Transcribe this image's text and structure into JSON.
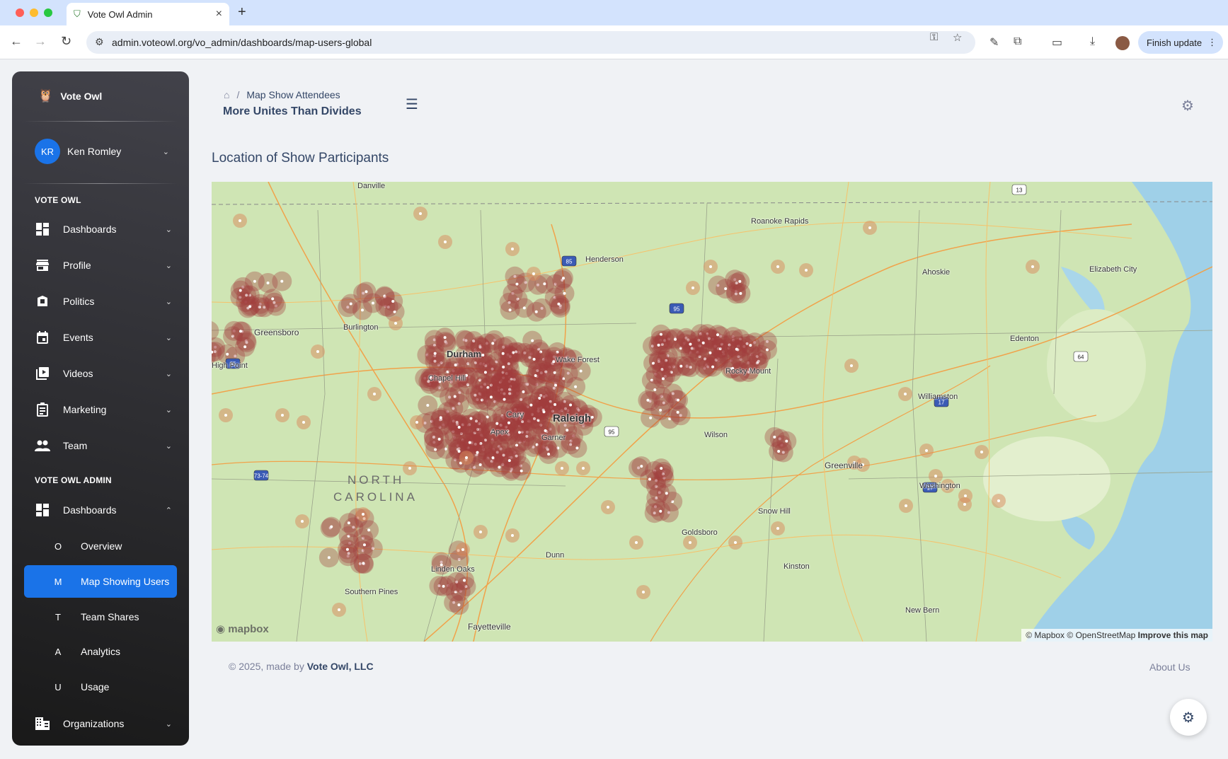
{
  "browser": {
    "tab_title": "Vote Owl Admin",
    "url": "admin.voteowl.org/vo_admin/dashboards/map-users-global",
    "finish_update_label": "Finish update",
    "traffic_colors": [
      "#ff5f57",
      "#febc2e",
      "#28c840"
    ]
  },
  "sidebar": {
    "brand": "Vote Owl",
    "user": {
      "initials": "KR",
      "name": "Ken Romley"
    },
    "section_main": "VOTE OWL",
    "items": [
      {
        "label": "Dashboards",
        "icon": "dashboard-icon"
      },
      {
        "label": "Profile",
        "icon": "store-icon"
      },
      {
        "label": "Politics",
        "icon": "ballot-icon"
      },
      {
        "label": "Events",
        "icon": "calendar-icon"
      },
      {
        "label": "Videos",
        "icon": "video-library-icon"
      },
      {
        "label": "Marketing",
        "icon": "clipboard-icon"
      },
      {
        "label": "Team",
        "icon": "people-icon"
      }
    ],
    "section_admin": "VOTE OWL ADMIN",
    "admin_dashboards_label": "Dashboards",
    "admin_sub_items": [
      {
        "letter": "O",
        "label": "Overview",
        "active": false
      },
      {
        "letter": "M",
        "label": "Map Showing Users",
        "active": true
      },
      {
        "letter": "T",
        "label": "Team Shares",
        "active": false
      },
      {
        "letter": "A",
        "label": "Analytics",
        "active": false
      },
      {
        "letter": "U",
        "label": "Usage",
        "active": false
      }
    ],
    "organizations_label": "Organizations",
    "active_color": "#1a73e8"
  },
  "header": {
    "breadcrumb_current": "Map Show Attendees",
    "page_title": "More Unites Than Divides"
  },
  "main": {
    "section_title": "Location of Show Participants",
    "map": {
      "labels": {
        "danville": "Danville",
        "roanoke_rapids": "Roanoke Rapids",
        "henderson": "Henderson",
        "ahoskie": "Ahoskie",
        "elizabeth_city": "Elizabeth City",
        "burlington": "Burlington",
        "greensboro": "Greensboro",
        "high_point": "High Point",
        "durham": "Durham",
        "chapel_hill": "Chapel Hill",
        "wake_forest": "Wake Forest",
        "rocky_mount": "Rocky Mount",
        "edenton": "Edenton",
        "cary": "Cary",
        "raleigh": "Raleigh",
        "apex": "Apex",
        "garner": "Garner",
        "wilson": "Wilson",
        "williamston": "Williamston",
        "north": "NORTH",
        "carolina": "CAROLINA",
        "greenville": "Greenville",
        "washington": "Washington",
        "snow_hill": "Snow Hill",
        "goldsboro": "Goldsboro",
        "dunn": "Dunn",
        "linden_oaks": "Linden Oaks",
        "kinston": "Kinston",
        "southern_pines": "Southern Pines",
        "new_bern": "New Bern",
        "fayetteville": "Fayetteville"
      },
      "shields": [
        "13",
        "85",
        "85",
        "95",
        "73-74",
        "95",
        "64",
        "17",
        "17"
      ],
      "logo": "mapbox",
      "attribution_1": "© Mapbox",
      "attribution_2": "© OpenStreetMap",
      "improve_link": "Improve this map",
      "heat_color": "#a03c3c"
    }
  },
  "footer": {
    "copyright_prefix": "© 2025, made by",
    "company": "Vote Owl, LLC",
    "about_link": "About Us"
  }
}
